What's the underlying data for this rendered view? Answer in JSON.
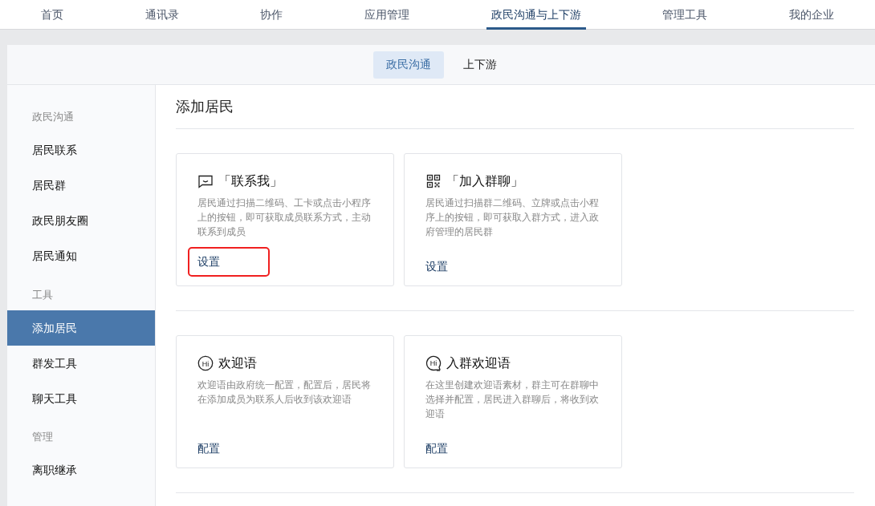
{
  "top_nav": [
    {
      "label": "首页",
      "selected": false
    },
    {
      "label": "通讯录",
      "selected": false
    },
    {
      "label": "协作",
      "selected": false
    },
    {
      "label": "应用管理",
      "selected": false
    },
    {
      "label": "政民沟通与上下游",
      "selected": true
    },
    {
      "label": "管理工具",
      "selected": false
    },
    {
      "label": "我的企业",
      "selected": false
    }
  ],
  "sub_tabs": [
    {
      "label": "政民沟通",
      "selected": true
    },
    {
      "label": "上下游",
      "selected": false
    }
  ],
  "sidebar": {
    "groups": [
      {
        "title": "政民沟通",
        "items": [
          {
            "label": "居民联系",
            "selected": false
          },
          {
            "label": "居民群",
            "selected": false
          },
          {
            "label": "政民朋友圈",
            "selected": false
          },
          {
            "label": "居民通知",
            "selected": false
          }
        ]
      },
      {
        "title": "工具",
        "items": [
          {
            "label": "添加居民",
            "selected": true
          },
          {
            "label": "群发工具",
            "selected": false
          },
          {
            "label": "聊天工具",
            "selected": false
          }
        ]
      },
      {
        "title": "管理",
        "items": [
          {
            "label": "离职继承",
            "selected": false
          }
        ]
      }
    ]
  },
  "page_title": "添加居民",
  "sections": [
    {
      "cards": [
        {
          "kind": "chat",
          "title": "「联系我」",
          "description": "居民通过扫描二维码、工卡或点击小程序上的按钮，即可获取成员联系方式，主动联系到成员",
          "action": "设置",
          "highlighted": true
        },
        {
          "kind": "qr",
          "title": "「加入群聊」",
          "description": "居民通过扫描群二维码、立牌或点击小程序上的按钮，即可获取入群方式，进入政府管理的居民群",
          "action": "设置",
          "highlighted": false
        }
      ]
    },
    {
      "cards": [
        {
          "kind": "hi",
          "icon_label": "Hi",
          "title": "欢迎语",
          "description": "欢迎语由政府统一配置，配置后，居民将在添加成员为联系人后收到该欢迎语",
          "action": "配置",
          "highlighted": false
        },
        {
          "kind": "hi-group",
          "icon_label": "Hi",
          "title": "入群欢迎语",
          "description": "在这里创建欢迎语素材，群主可在群聊中选择并配置，居民进入群聊后，将收到欢迎语",
          "action": "配置",
          "highlighted": false
        }
      ]
    }
  ]
}
